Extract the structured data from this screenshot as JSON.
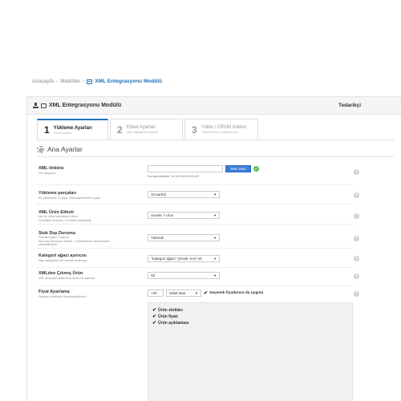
{
  "breadcrumb": {
    "items": [
      "Anasayfa",
      "Modüller"
    ],
    "current": "XML Entegrasyonu Modülü",
    "separator": "›"
  },
  "panel": {
    "title": "XML Entegrasyonu Modülü",
    "right_link": "Tedarikçi"
  },
  "steps": [
    {
      "num": "1",
      "label": "Yükleme Ayarları",
      "sub": "Genel ayarlar"
    },
    {
      "num": "2",
      "label": "Etiket Ayarları",
      "sub": "XML etiketlerini eşleme"
    },
    {
      "num": "3",
      "label": "Yükle / CRON linkleri",
      "sub": "Yükleme/Cron linklerini Alın"
    }
  ],
  "section_title": "Ana Ayarlar",
  "rows": {
    "xml_link": {
      "label": "XML linkiniz",
      "desc": "Xml dosyanız",
      "input_value": "",
      "button": "XML Getir",
      "note": "Son güncelleme: 11.11.2019 09:21:49"
    },
    "parts": {
      "label": "Yükleme parçaları",
      "desc": "Ek yüklemede 10 yaptı. Güncellemelerde 1 yaptı.",
      "value": "10 part(s)"
    },
    "product_tag": {
      "label": "XML Ürün Etiketi",
      "desc": [
        "Her bir ürünü çevreleyen etiket.",
        "Genellikle Products > Product şeklindedir."
      ],
      "value": "urunler > urun"
    },
    "stock": {
      "label": "Stok Dışı Durumu",
      "desc": [
        "Önerilen Ayarı: Tükendi",
        "Stok dışı durumları Sistem > Yerelleştirme menüsünden",
        "ekleyebilirsiniz"
      ],
      "value": "Tükendi"
    },
    "category": {
      "label": "Kategori ağacı ayırıcısı",
      "desc": "Eğer kategoriler tek etikette verilmişse",
      "value": "\"Kategori ağacı\" (örnek: KAT AK"
    },
    "removed": {
      "label": "XMLden Çıkmış Ürün",
      "desc": "XML dosyadan kaldırılmış ürüne ne yapılsın",
      "value": "Sil"
    },
    "price": {
      "label": "Fiyat Ayarlama",
      "desc": "Fiyatları yüzdelikle düzenleyebilirsiniz",
      "amount": "+20",
      "type": "Sabit tutar",
      "check_label": "Seçenek fiyatlarına da uygula"
    }
  },
  "options": [
    "Ürün stokları",
    "Ürün fiyatı",
    "Ürün açıklaması"
  ],
  "help_glyph": "?",
  "tick_glyph": "✔",
  "caret_glyph": "▼"
}
